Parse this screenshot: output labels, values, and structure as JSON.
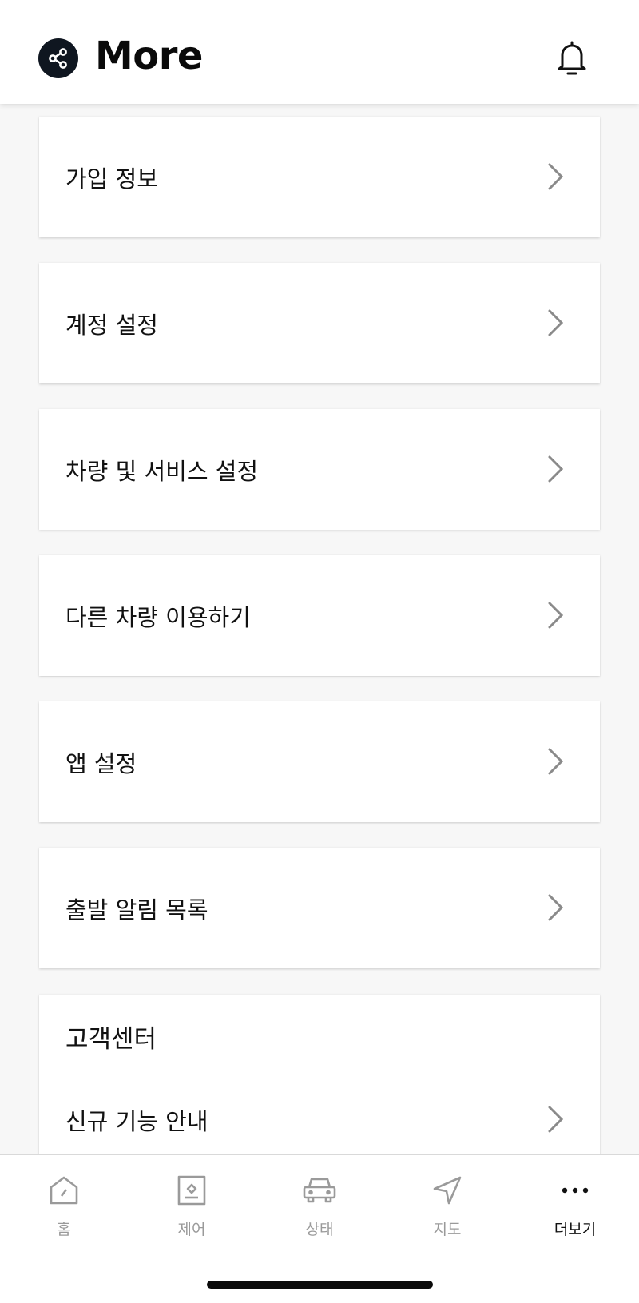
{
  "header": {
    "title": "More",
    "share_icon": "share-icon",
    "bell_icon": "bell-icon"
  },
  "menu": [
    {
      "label": "가입 정보"
    },
    {
      "label": "계정 설정"
    },
    {
      "label": "차량 및 서비스 설정"
    },
    {
      "label": "다른 차량 이용하기"
    },
    {
      "label": "앱 설정"
    },
    {
      "label": "출발 알림 목록"
    }
  ],
  "support": {
    "title": "고객센터",
    "items": [
      {
        "label": "신규 기능 안내"
      }
    ]
  },
  "tabbar": {
    "tabs": [
      {
        "label": "홈",
        "icon": "home-icon"
      },
      {
        "label": "제어",
        "icon": "control-icon"
      },
      {
        "label": "상태",
        "icon": "car-icon"
      },
      {
        "label": "지도",
        "icon": "navigation-icon"
      },
      {
        "label": "더보기",
        "icon": "more-dots-icon",
        "active": true
      }
    ]
  },
  "colors": {
    "accent_dark": "#0f1620",
    "background": "#f7f7f7",
    "inactive": "#9a9a9a"
  }
}
